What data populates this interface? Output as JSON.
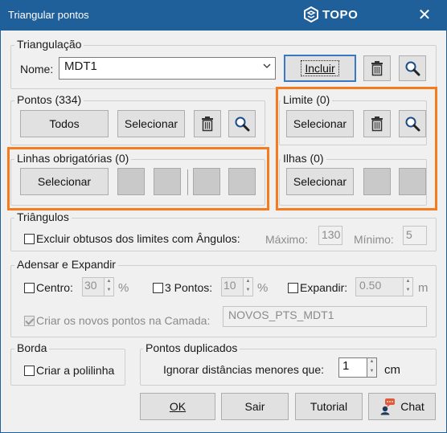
{
  "window": {
    "title": "Triangular pontos",
    "brand": "TOPO",
    "close_glyph": "✕"
  },
  "triangulacao": {
    "group_label": "Triangulação",
    "name_label": "Nome:",
    "name_value": "MDT1",
    "include_button": "Incluir"
  },
  "pontos": {
    "group_label": "Pontos (334)",
    "all_button": "Todos",
    "select_button": "Selecionar"
  },
  "limite": {
    "group_label": "Limite (0)",
    "select_button": "Selecionar"
  },
  "linhas": {
    "group_label": "Linhas obrigatórias (0)",
    "select_button": "Selecionar"
  },
  "ilhas": {
    "group_label": "Ilhas (0)",
    "select_button": "Selecionar"
  },
  "triangulos": {
    "group_label": "Triângulos",
    "exclude_label": "Excluir obtusos dos limites com Ângulos:",
    "max_label": "Máximo:",
    "max_value": "130",
    "min_label": "Mínimo:",
    "min_value": "5"
  },
  "adensar": {
    "group_label": "Adensar e Expandir",
    "center_label": "Centro:",
    "center_value": "30",
    "center_unit": "%",
    "three_points_label": "3 Pontos:",
    "three_points_value": "10",
    "three_points_unit": "%",
    "expand_label": "Expandir:",
    "expand_value": "0.50",
    "expand_unit": "m",
    "layer_label": "Criar os novos pontos na Camada:",
    "layer_value": "NOVOS_PTS_MDT1"
  },
  "borda": {
    "group_label": "Borda",
    "polyline_label": "Criar a polilinha"
  },
  "duplicados": {
    "group_label": "Pontos duplicados",
    "ignore_label": "Ignorar distâncias menores que:",
    "ignore_value": "1",
    "unit": "cm"
  },
  "footer": {
    "ok": "OK",
    "exit": "Sair",
    "tutorial": "Tutorial",
    "chat": "Chat"
  },
  "colors": {
    "titlebar": "#1f5f9a",
    "highlight": "#f47b20",
    "chat_badge": "#e05a3a"
  }
}
